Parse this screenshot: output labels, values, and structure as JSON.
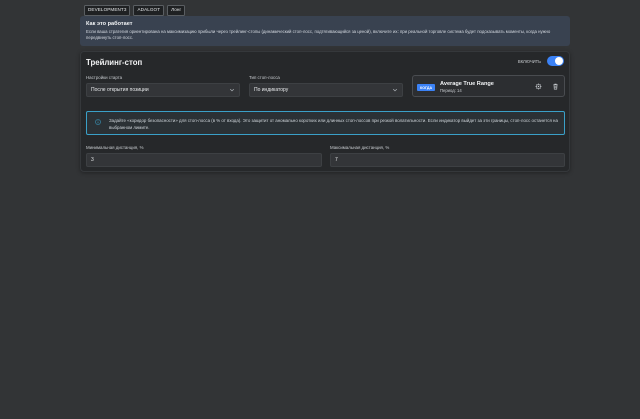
{
  "tags": [
    "DEVELOPMENT3",
    "ADALGOT",
    "Лонг"
  ],
  "info": {
    "title": "Как это работает",
    "text": "Если ваша стратегия ориентирована на максимизацию прибыли через трейлинг-стопы (динамический стоп-лосс, подтягивающийся за ценой), включите их: при реальной торговле система будет подсказывать моменты, когда нужно передвинуть стоп-лосс."
  },
  "card": {
    "title": "Трейлинг-стоп",
    "toggle_label": "ВКЛЮЧИТЬ",
    "toggle_on": true,
    "start_label": "Настройки старта",
    "start_value": "После открытия позиции",
    "type_label": "Тип стоп-лосса",
    "type_value": "По индикатору",
    "indicator": {
      "badge": "КОГДА",
      "name": "Average True Range",
      "period": "Период: 14",
      "settings_icon": "gear-icon",
      "delete_icon": "trash-icon"
    },
    "alert_icon": "info-icon",
    "alert_text": "Задайте «коридор безопасности» для стоп-лосса (в % от входа). Это защитит от аномально коротких или длинных стоп-лоссов при резкой волатильности. Если индикатор выйдет за эти границы, стоп-лосс останется на выбранном лимите.",
    "min_label": "Минимальная дистанция, %",
    "min_value": "3",
    "max_label": "Максимальная дистанция, %",
    "max_value": "7"
  },
  "colors": {
    "accent": "#3b82f6",
    "alert_border": "#3aa0c8",
    "background": "#323436",
    "card": "#26282a"
  }
}
